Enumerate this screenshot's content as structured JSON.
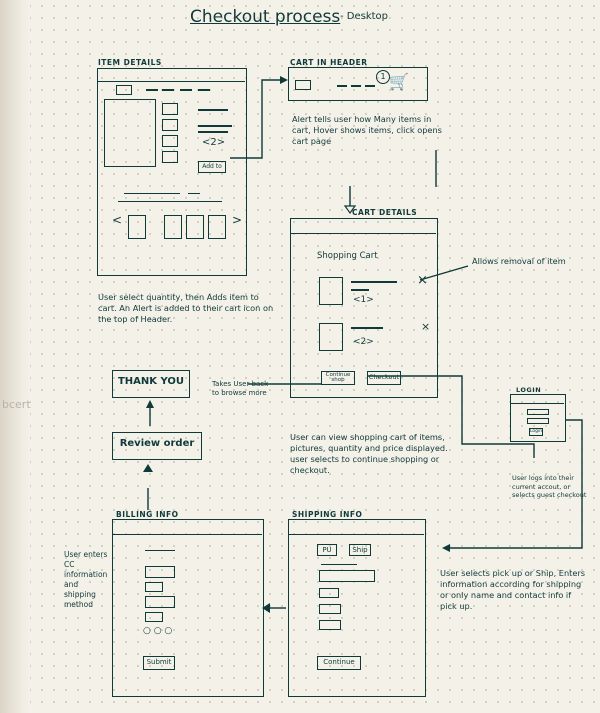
{
  "title": "Checkout process",
  "subtitle": "- Desktop",
  "margin_note": "bcert",
  "frames": {
    "item_details": "ITEM DETAILS",
    "cart_in_header": "CART IN HEADER",
    "cart_details": "CART DETAILS",
    "login": "LOGIN",
    "billing_info": "BILLING INFO",
    "shipping_info": "SHIPPING INFO"
  },
  "item_details": {
    "qty": "<2>",
    "add_button": "Add to"
  },
  "cart_header": {
    "badge": "1"
  },
  "cart_details": {
    "heading": "Shopping Cart",
    "item1_qty": "<1>",
    "item2_qty": "<2>",
    "remove_mark": "×",
    "continue_button": "Continue shop",
    "checkout_button": "Checkout"
  },
  "login": {
    "button": "Login"
  },
  "billing": {
    "submit_button": "Submit"
  },
  "shipping": {
    "option1": "PU",
    "option2": "Ship",
    "continue_button": "Continue"
  },
  "flow": {
    "thank_you": "THANK YOU",
    "review_order": "Review order"
  },
  "notes": {
    "cart_header": "Alert tells user how Many items in cart, Hover shows items, click opens cart page",
    "remove": "Allows removal of item",
    "item_details": "User select quantity, then Adds item to cart. An Alert is added to their cart icon on the top of Header.",
    "continue": "Takes User back to browse more",
    "cart_view": "User can view shopping cart of items, pictures, quantity and price displayed. user selects to continue shopping or checkout.",
    "login": "User logs into their current accout, or selects guest checkout",
    "billing": "User enters CC information and shipping method",
    "shipping": "User selects pick up or Ship, Enters information according for shipping or only name and contact info if pick up."
  }
}
